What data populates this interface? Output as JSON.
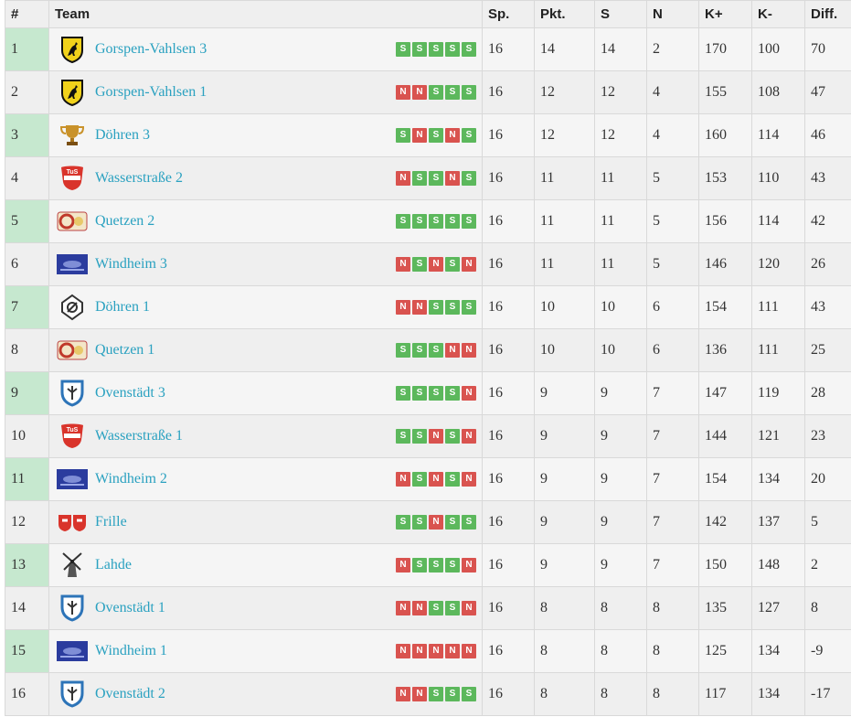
{
  "headers": {
    "rank": "#",
    "team": "Team",
    "played": "Sp.",
    "points": "Pkt.",
    "wins": "S",
    "losses": "N",
    "kplus": "K+",
    "kminus": "K-",
    "diff": "Diff."
  },
  "colors": {
    "win": "#5cb85c",
    "loss": "#d9534f",
    "link": "#2aa1c0",
    "rank_highlight": "#c6e8cf"
  },
  "rows": [
    {
      "rank": "1",
      "team": "Gorspen-Vahlsen 3",
      "logo": "stallion-shield-icon",
      "form": [
        "S",
        "S",
        "S",
        "S",
        "S"
      ],
      "played": "16",
      "points": "14",
      "wins": "14",
      "losses": "2",
      "kplus": "170",
      "kminus": "100",
      "diff": "70"
    },
    {
      "rank": "2",
      "team": "Gorspen-Vahlsen 1",
      "logo": "stallion-shield-icon",
      "form": [
        "N",
        "N",
        "S",
        "S",
        "S"
      ],
      "played": "16",
      "points": "12",
      "wins": "12",
      "losses": "4",
      "kplus": "155",
      "kminus": "108",
      "diff": "47"
    },
    {
      "rank": "3",
      "team": "Döhren 3",
      "logo": "trophy-icon",
      "form": [
        "S",
        "N",
        "S",
        "N",
        "S"
      ],
      "played": "16",
      "points": "12",
      "wins": "12",
      "losses": "4",
      "kplus": "160",
      "kminus": "114",
      "diff": "46"
    },
    {
      "rank": "4",
      "team": "Wasserstraße 2",
      "logo": "tus-crest-icon",
      "form": [
        "N",
        "S",
        "S",
        "N",
        "S"
      ],
      "played": "16",
      "points": "11",
      "wins": "11",
      "losses": "5",
      "kplus": "153",
      "kminus": "110",
      "diff": "43"
    },
    {
      "rank": "5",
      "team": "Quetzen 2",
      "logo": "quetzen-logo-icon",
      "form": [
        "S",
        "S",
        "S",
        "S",
        "S"
      ],
      "played": "16",
      "points": "11",
      "wins": "11",
      "losses": "5",
      "kplus": "156",
      "kminus": "114",
      "diff": "42"
    },
    {
      "rank": "6",
      "team": "Windheim 3",
      "logo": "windheim-logo-icon",
      "form": [
        "N",
        "S",
        "N",
        "S",
        "N"
      ],
      "played": "16",
      "points": "11",
      "wins": "11",
      "losses": "5",
      "kplus": "146",
      "kminus": "120",
      "diff": "26"
    },
    {
      "rank": "7",
      "team": "Döhren 1",
      "logo": "doehren-badge-icon",
      "form": [
        "N",
        "N",
        "S",
        "S",
        "S"
      ],
      "played": "16",
      "points": "10",
      "wins": "10",
      "losses": "6",
      "kplus": "154",
      "kminus": "111",
      "diff": "43"
    },
    {
      "rank": "8",
      "team": "Quetzen 1",
      "logo": "quetzen-logo-icon",
      "form": [
        "S",
        "S",
        "S",
        "N",
        "N"
      ],
      "played": "16",
      "points": "10",
      "wins": "10",
      "losses": "6",
      "kplus": "136",
      "kminus": "111",
      "diff": "25"
    },
    {
      "rank": "9",
      "team": "Ovenstädt 3",
      "logo": "ovenstaedt-shield-icon",
      "form": [
        "S",
        "S",
        "S",
        "S",
        "N"
      ],
      "played": "16",
      "points": "9",
      "wins": "9",
      "losses": "7",
      "kplus": "147",
      "kminus": "119",
      "diff": "28"
    },
    {
      "rank": "10",
      "team": "Wasserstraße 1",
      "logo": "tus-crest-icon",
      "form": [
        "S",
        "S",
        "N",
        "S",
        "N"
      ],
      "played": "16",
      "points": "9",
      "wins": "9",
      "losses": "7",
      "kplus": "144",
      "kminus": "121",
      "diff": "23"
    },
    {
      "rank": "11",
      "team": "Windheim 2",
      "logo": "windheim-logo-icon",
      "form": [
        "N",
        "S",
        "N",
        "S",
        "N"
      ],
      "played": "16",
      "points": "9",
      "wins": "9",
      "losses": "7",
      "kplus": "154",
      "kminus": "134",
      "diff": "20"
    },
    {
      "rank": "12",
      "team": "Frille",
      "logo": "frille-logo-icon",
      "form": [
        "S",
        "S",
        "N",
        "S",
        "S"
      ],
      "played": "16",
      "points": "9",
      "wins": "9",
      "losses": "7",
      "kplus": "142",
      "kminus": "137",
      "diff": "5"
    },
    {
      "rank": "13",
      "team": "Lahde",
      "logo": "windmill-icon",
      "form": [
        "N",
        "S",
        "S",
        "S",
        "N"
      ],
      "played": "16",
      "points": "9",
      "wins": "9",
      "losses": "7",
      "kplus": "150",
      "kminus": "148",
      "diff": "2"
    },
    {
      "rank": "14",
      "team": "Ovenstädt 1",
      "logo": "ovenstaedt-shield-icon",
      "form": [
        "N",
        "N",
        "S",
        "S",
        "N"
      ],
      "played": "16",
      "points": "8",
      "wins": "8",
      "losses": "8",
      "kplus": "135",
      "kminus": "127",
      "diff": "8"
    },
    {
      "rank": "15",
      "team": "Windheim 1",
      "logo": "windheim-logo-icon",
      "form": [
        "N",
        "N",
        "N",
        "N",
        "N"
      ],
      "played": "16",
      "points": "8",
      "wins": "8",
      "losses": "8",
      "kplus": "125",
      "kminus": "134",
      "diff": "-9"
    },
    {
      "rank": "16",
      "team": "Ovenstädt 2",
      "logo": "ovenstaedt-shield-icon",
      "form": [
        "N",
        "N",
        "S",
        "S",
        "S"
      ],
      "played": "16",
      "points": "8",
      "wins": "8",
      "losses": "8",
      "kplus": "117",
      "kminus": "134",
      "diff": "-17"
    }
  ]
}
